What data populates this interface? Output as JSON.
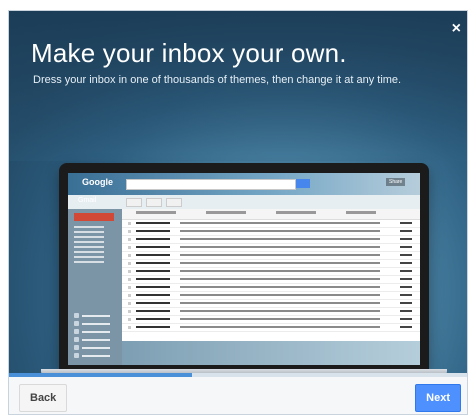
{
  "dialog": {
    "headline": "Make your inbox your own.",
    "subline": "Dress your inbox in one of thousands of themes, then change it at any time.",
    "close_glyph": "×"
  },
  "preview": {
    "logo": "Google",
    "app_label": "Gmail",
    "share_label": "Share"
  },
  "progress": {
    "fraction": 0.4
  },
  "footer": {
    "back_label": "Back",
    "next_label": "Next"
  },
  "colors": {
    "next_button": "#4d90fe",
    "progress_fill": "#4a90d9"
  }
}
